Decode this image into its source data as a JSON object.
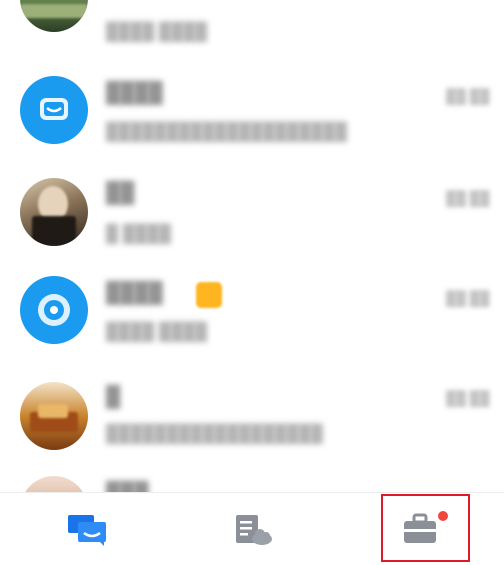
{
  "conversations": [
    {
      "name": "██████",
      "preview": "████ ████",
      "time": "",
      "avatar": "landscape-photo"
    },
    {
      "name": "████",
      "preview": "████████████████████",
      "time": "██:██",
      "avatar": "blue-chat-icon"
    },
    {
      "name": "██",
      "preview": "█ ████",
      "time": "██:██",
      "avatar": "person-photo"
    },
    {
      "name": "████",
      "preview": "████ ████",
      "time": "██:██",
      "avatar": "blue-app-icon"
    },
    {
      "name": "█",
      "preview": "██████████████████",
      "time": "██:██",
      "avatar": "autumn-photo"
    },
    {
      "name": "███",
      "preview": "",
      "time": "",
      "avatar": "food-photo"
    }
  ],
  "tabs": [
    {
      "name": "messages",
      "icon": "chat-bubbles-icon",
      "active": true
    },
    {
      "name": "docs",
      "icon": "cloud-document-icon",
      "active": false
    },
    {
      "name": "workbench",
      "icon": "briefcase-icon",
      "active": false,
      "badge": true
    }
  ],
  "colors": {
    "accent": "#1a73e8",
    "badge": "#f2453d",
    "highlight": "#e11a2b",
    "avatar_blue": "#1a9bf0"
  }
}
